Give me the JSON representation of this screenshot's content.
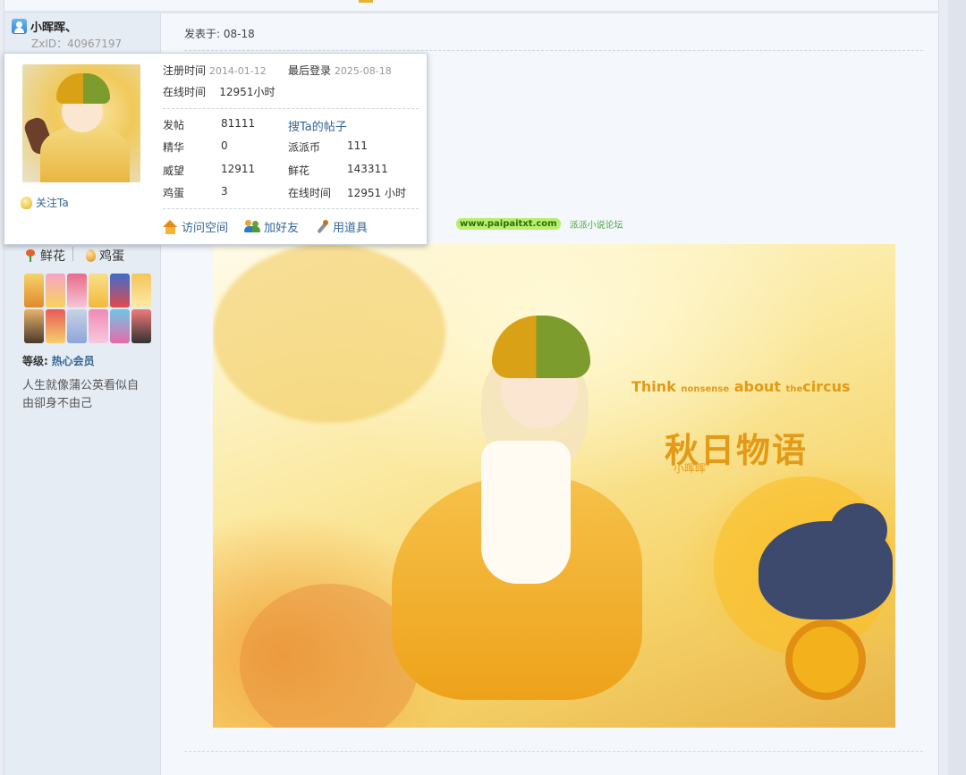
{
  "user": {
    "name": "小晖晖、",
    "zxid": "ZxID：40967197",
    "flowers_label": "鲜花",
    "eggs_label": "鸡蛋",
    "level_label": "等级:",
    "level_value": "热心会员",
    "signature": "人生就像蒲公英看似自由卻身不由己"
  },
  "popup": {
    "register_label": "注册时间",
    "register_value": "2014-01-12",
    "lastlogin_label": "最后登录",
    "lastlogin_value": "2025-08-18",
    "online_label": "在线时间",
    "online_value": "12951小时",
    "follow_label": "关注Ta",
    "stats": [
      {
        "label": "发帖",
        "value": "81111"
      },
      {
        "label": "搜Ta的帖子",
        "value": ""
      },
      {
        "label": "精华",
        "value": "0"
      },
      {
        "label": "派派币",
        "value": "111"
      },
      {
        "label": "威望",
        "value": "12911"
      },
      {
        "label": "鲜花",
        "value": "143311"
      },
      {
        "label": "鸡蛋",
        "value": "3"
      },
      {
        "label": "在线时间",
        "value": "12951 小时"
      }
    ],
    "actions": {
      "visit": "访问空间",
      "add_friend": "加好友",
      "use_tool": "用道具"
    }
  },
  "post": {
    "time": "发表于: 08-18",
    "sig_url": "www.paipaitxt.com",
    "sig_forum": "派派小说论坛"
  },
  "artwork": {
    "subtitle_prefix": "Think",
    "subtitle_small": "nonsense",
    "subtitle_mid": "about",
    "subtitle_small2": "the",
    "subtitle_end": "circus",
    "title": "秋日物语",
    "author": "小晖晖"
  },
  "colors": {
    "link": "#336699",
    "accent": "#e39a16"
  }
}
